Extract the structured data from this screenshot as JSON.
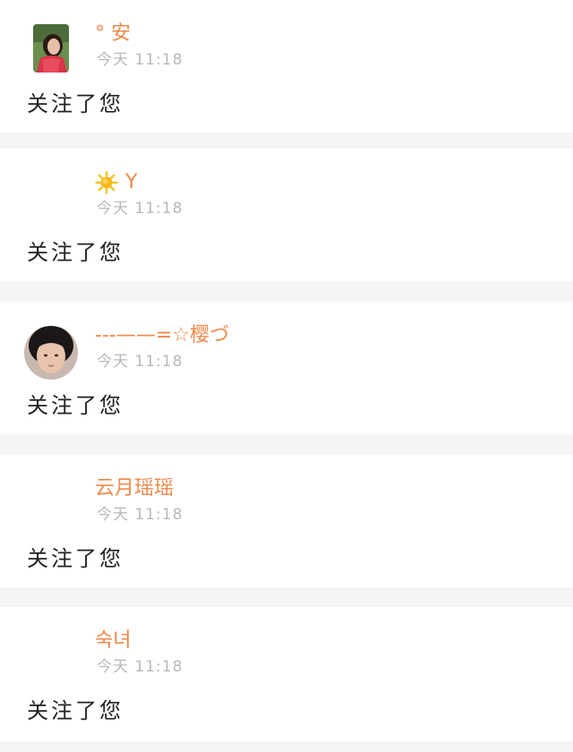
{
  "notifications": [
    {
      "username": "° 安",
      "time_label": "今天  11:18",
      "action": "关注了您",
      "avatar": "photo-avatar"
    },
    {
      "username": "Y",
      "username_icon": "sun-icon",
      "time_label": "今天  11:18",
      "action": "关注了您",
      "avatar": "none"
    },
    {
      "username": "---——=☆樱づ",
      "time_label": "今天  11:18",
      "action": "关注了您",
      "avatar": "photo-avatar-round"
    },
    {
      "username": "云月瑶瑶",
      "time_label": "今天  11:18",
      "action": "关注了您",
      "avatar": "none"
    },
    {
      "username": "숙녀",
      "time_label": "今天  11:18",
      "action": "关注了您",
      "avatar": "none"
    }
  ],
  "colors": {
    "username": "#f0884a",
    "time": "#b8b8b8",
    "action": "#222222",
    "separator": "#f5f5f5",
    "card": "#ffffff"
  }
}
